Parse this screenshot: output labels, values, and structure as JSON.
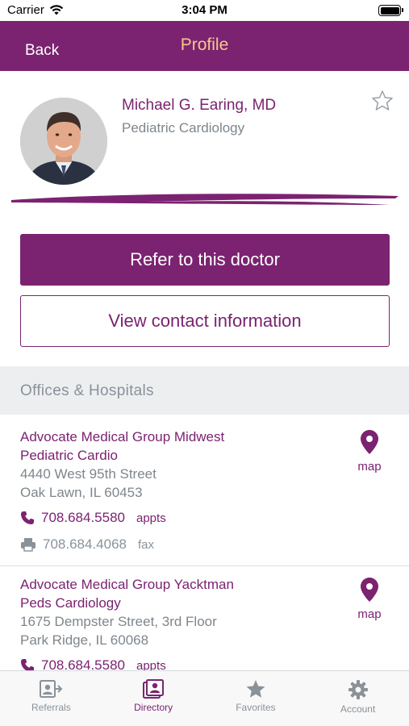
{
  "status_bar": {
    "carrier": "Carrier",
    "time": "3:04 PM"
  },
  "header": {
    "back_label": "Back",
    "title": "Profile"
  },
  "colors": {
    "brand": "#7b2271",
    "title_accent": "#f6c98a",
    "muted": "#8a9299"
  },
  "profile": {
    "name": "Michael G. Earing, MD",
    "specialty": "Pediatric Cardiology"
  },
  "actions": {
    "refer_label": "Refer to this doctor",
    "contact_label": "View contact information"
  },
  "offices_section": {
    "title": "Offices & Hospitals"
  },
  "offices": [
    {
      "org_line1": "Advocate Medical Group Midwest",
      "org_line2": "Pediatric Cardio",
      "address_line1": "4440 West 95th Street",
      "address_line2": "Oak Lawn, IL 60453",
      "phone": "708.684.5580",
      "phone_tag": "appts",
      "fax": "708.684.4068",
      "fax_tag": "fax",
      "map_label": "map"
    },
    {
      "org_line1": "Advocate Medical Group Yacktman",
      "org_line2": "Peds Cardiology",
      "address_line1": "1675 Dempster Street, 3rd Floor",
      "address_line2": "Park Ridge, IL 60068",
      "phone": "708.684.5580",
      "phone_tag": "appts",
      "map_label": "map"
    }
  ],
  "tabbar": {
    "items": [
      {
        "label": "Referrals",
        "icon": "referrals-icon"
      },
      {
        "label": "Directory",
        "icon": "directory-icon",
        "active": true
      },
      {
        "label": "Favorites",
        "icon": "star-icon"
      },
      {
        "label": "Account",
        "icon": "gear-icon"
      }
    ]
  }
}
